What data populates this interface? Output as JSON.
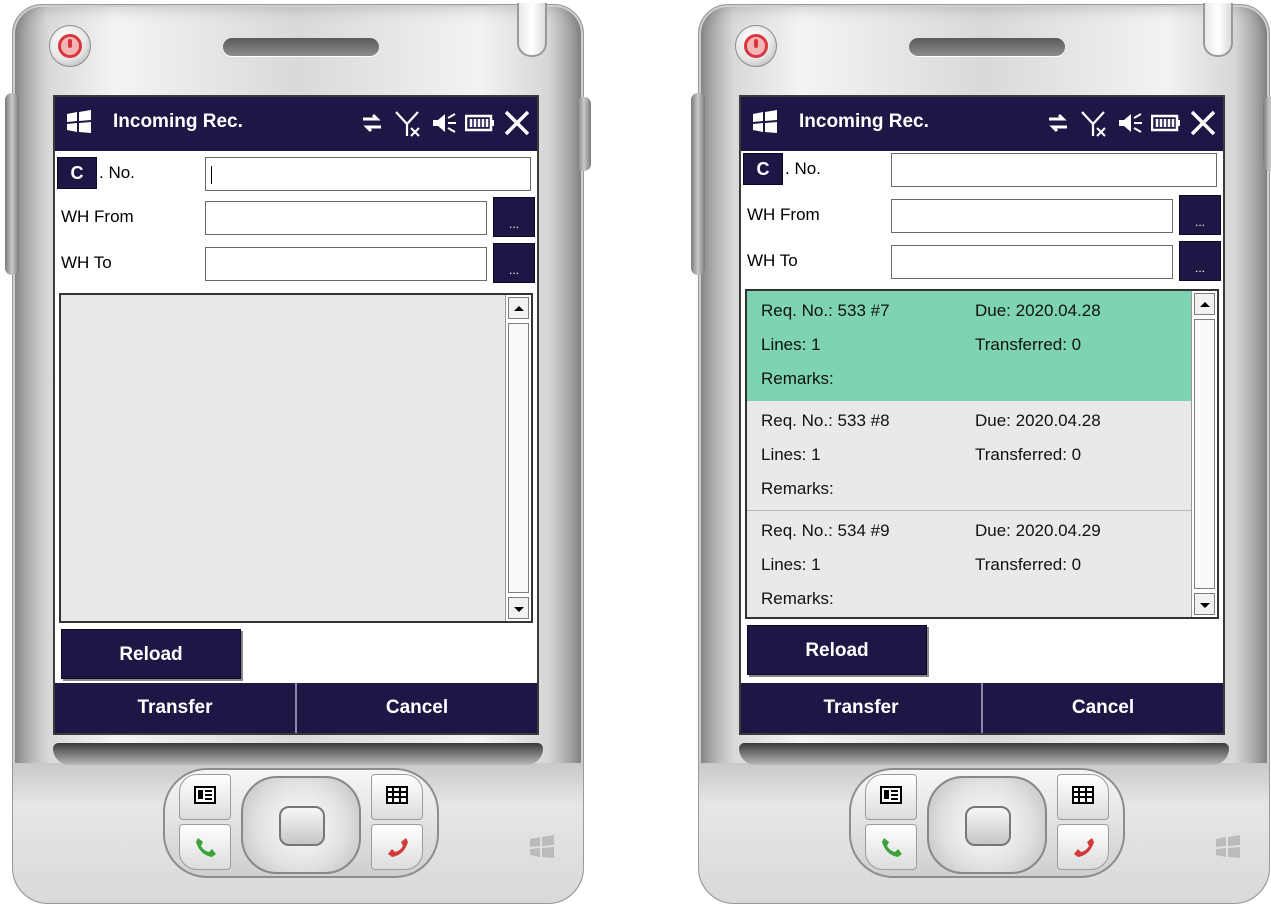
{
  "screens": [
    {
      "app_title": "Incoming Rec.",
      "c_button": "C",
      "c_label": ". No.",
      "wh_from_label": "WH From",
      "wh_to_label": "WH To",
      "c_no_value": "",
      "wh_from_value": "",
      "wh_to_value": "",
      "browse_label": "...",
      "reload_label": "Reload",
      "transfer_label": "Transfer",
      "cancel_label": "Cancel",
      "list_items": []
    },
    {
      "app_title": "Incoming Rec.",
      "c_button": "C",
      "c_label": ". No.",
      "wh_from_label": "WH From",
      "wh_to_label": "WH To",
      "c_no_value": "",
      "wh_from_value": "",
      "wh_to_value": "",
      "browse_label": "...",
      "reload_label": "Reload",
      "transfer_label": "Transfer",
      "cancel_label": "Cancel",
      "list_items": [
        {
          "req": "Req. No.: 533 #7",
          "due": "Due: 2020.04.28",
          "lines": "Lines: 1",
          "transferred": "Transferred: 0",
          "remarks": "Remarks:",
          "selected": true
        },
        {
          "req": "Req. No.: 533 #8",
          "due": "Due: 2020.04.28",
          "lines": "Lines: 1",
          "transferred": "Transferred: 0",
          "remarks": "Remarks:",
          "selected": false
        },
        {
          "req": "Req. No.: 534 #9",
          "due": "Due: 2020.04.29",
          "lines": "Lines: 1",
          "transferred": "Transferred: 0",
          "remarks": "Remarks:",
          "selected": false
        }
      ]
    }
  ],
  "colors": {
    "titlebar": "#1e1745",
    "selected_row": "#7dd3b2",
    "list_background": "#e9e9e9"
  },
  "icons": [
    "windows-flag-icon",
    "sync-icon",
    "no-signal-icon",
    "speaker-icon",
    "battery-icon",
    "close-icon"
  ]
}
